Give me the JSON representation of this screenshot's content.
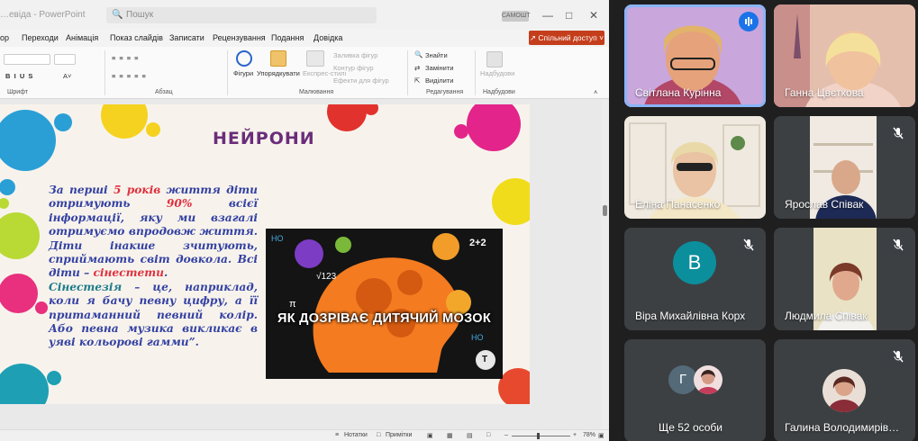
{
  "powerpoint": {
    "title": {
      "doc_name": "…евіда - PowerPoint",
      "search_placeholder": "Пошук",
      "badge": "САМОШТ"
    },
    "menu": [
      "ор",
      "Переходи",
      "Анімація",
      "Показ слайдів",
      "Записати",
      "Рецензування",
      "Подання",
      "Довідка"
    ],
    "share_button": "Спільний доступ",
    "ribbon": {
      "groups": {
        "font": "Шрифт",
        "paragraph": "Абзац",
        "drawing": "Малювання",
        "editing": "Редагування",
        "addins": "Надбудови"
      },
      "tools": {
        "shapes": "Фігури",
        "arrange": "Упорядкувати",
        "quick_styles": "Експрес-стилі",
        "shape_fill": "Заливка фігур",
        "shape_outline": "Контур фігур",
        "shape_effects": "Ефекти для фігур",
        "find": "Знайти",
        "replace": "Замінити",
        "select": "Виділити",
        "addins_button": "Надбудови"
      }
    },
    "slide": {
      "title": "НЕЙРОНИ",
      "text": {
        "p1_a": "За перші ",
        "p1_b": "5 років",
        "p1_c": " життя діти отримують ",
        "p1_d": "90%",
        "p1_e": " всієї інформації, яку ми взагалі отримуємо впродовж життя. Діти інакше зчитують, сприймають світ довкола. Всі діти – ",
        "p1_f": "сінестети",
        "p1_g": ".",
        "p2_a": "Сінестезія",
        "p2_b": " – це, наприклад, коли я бачу певну цифру, а її притаманний певний колір. Або певна музика викликає в уяві кольорові гамми”."
      },
      "image_caption": "ЯК ДОЗРІВАЄ ДИТЯЧИЙ МОЗОК",
      "image_labels": [
        "НО",
        "2+2",
        "√123",
        "π",
        "НО",
        "Т"
      ]
    },
    "status": {
      "notes": "Нотатки",
      "comments": "Примітки",
      "zoom": "78%"
    }
  },
  "meet": {
    "participants": [
      {
        "name": "Світлана Курінна",
        "speaking": true
      },
      {
        "name": "Ганна Цвєткова",
        "muted": false
      },
      {
        "name": "Еліна Панасенко",
        "muted": false
      },
      {
        "name": "Ярослав Співак",
        "muted": true
      },
      {
        "name": "Віра Михайлівна Корх",
        "muted": true,
        "initial": "В"
      },
      {
        "name": "Людмила Співак",
        "muted": true
      },
      {
        "name": "Ще 52 особи",
        "initial": "Г"
      },
      {
        "name": "Галина Володимирів…",
        "muted": true
      }
    ]
  },
  "colors": {
    "share_button": "#c43e1c",
    "slide_title": "#6b2d7a",
    "slide_text": "#3441a3",
    "slide_highlight": "#e0303e",
    "meet_tile": "#3c4043",
    "avatar_teal": "#0b8f9c",
    "active_ring": "#8ab4f8"
  }
}
